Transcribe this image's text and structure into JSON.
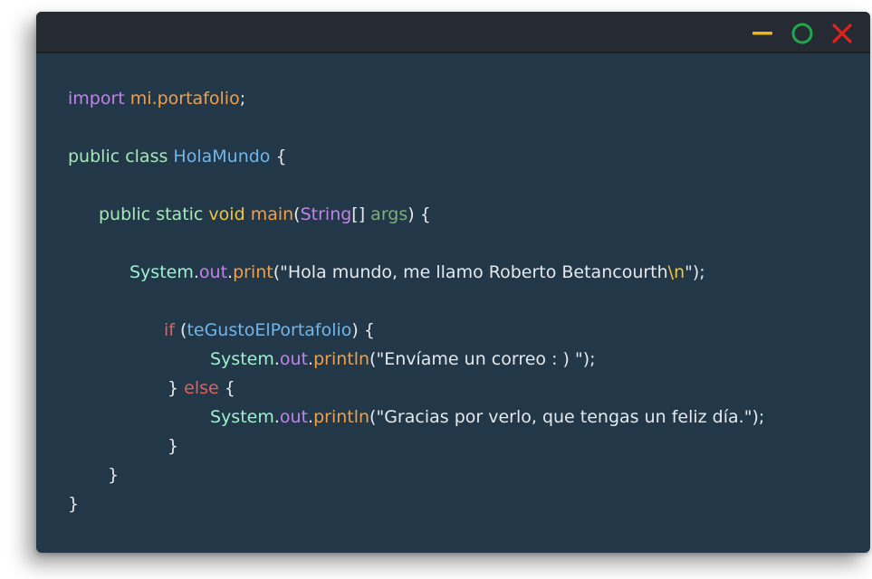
{
  "window_controls": {
    "minimize_icon": "minimize-icon",
    "maximize_icon": "maximize-icon",
    "close_icon": "close-icon",
    "colors": {
      "minimize": "#f0b41c",
      "maximize": "#1fa84a",
      "close": "#e0241c"
    }
  },
  "code_colors": {
    "background": "#223747",
    "titlebar": "#252a33"
  },
  "code": {
    "l1": {
      "kw": "import",
      "sp": " ",
      "pkg": "mi.portafolio",
      "semi": ";"
    },
    "l2": {
      "pub": "public class",
      "sp": " ",
      "cls": "HolaMundo",
      "sp2": " ",
      "brace": "{"
    },
    "l3": {
      "mods": "public static",
      "sp": " ",
      "void": "void",
      "sp2": " ",
      "name": "main",
      "open": "(",
      "type": "String",
      "arr": "[]",
      "sp3": " ",
      "arg": "args",
      "close": ")",
      "sp4": " ",
      "brace": "{"
    },
    "l4": {
      "sys": "System",
      "dot": ".",
      "out": "out",
      "dot2": ".",
      "fn": "print",
      "open": "(",
      "str": "\"Hola mundo, me llamo Roberto Betancourth",
      "esc": "\\n",
      "strend": "\"",
      "close": ");"
    },
    "l5": {
      "if": "if",
      "sp": " ",
      "open": "(",
      "cond": "teGustoElPortafolio",
      "close": ")",
      "sp2": " ",
      "brace": "{"
    },
    "l6": {
      "sys": "System",
      "dot": ".",
      "out": "out",
      "dot2": ".",
      "fn": "println",
      "open": "(",
      "str": "\"Envíame un correo : ) \"",
      "close": ");"
    },
    "l7": {
      "brace": "}",
      "sp": " ",
      "else": "else",
      "sp2": " ",
      "brace2": "{"
    },
    "l8": {
      "sys": "System",
      "dot": ".",
      "out": "out",
      "dot2": ".",
      "fn": "println",
      "open": "(",
      "str": "\"Gracias por verlo, que tengas un feliz día.\"",
      "close": ");"
    },
    "l9": {
      "brace": "}"
    },
    "l10": {
      "brace": "}"
    },
    "l11": {
      "brace": "}"
    }
  }
}
